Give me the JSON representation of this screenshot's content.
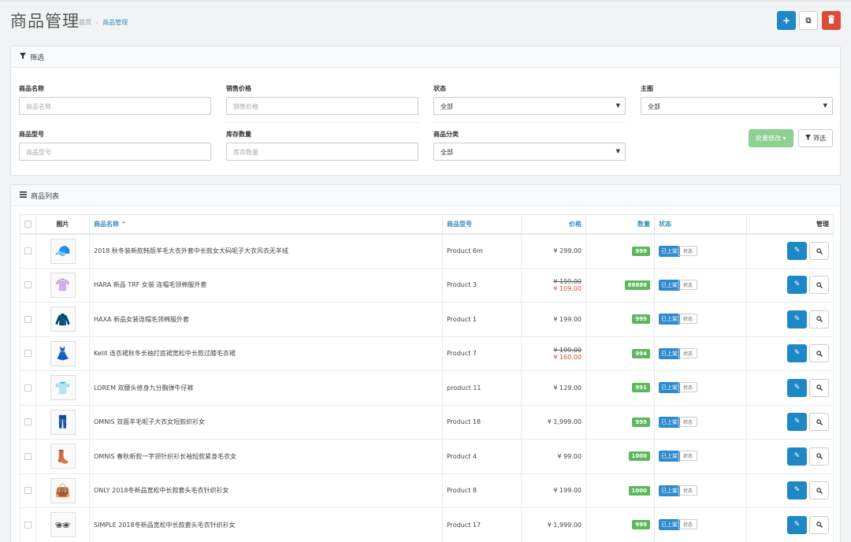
{
  "header": {
    "title": "商品管理",
    "crumb_home": "首页",
    "crumb_sep": "›",
    "crumb_current": "商品管理",
    "add_icon": "+",
    "copy_icon": "⧉",
    "delete_icon": "🗑"
  },
  "filter": {
    "title": "筛选",
    "name_label": "商品名称",
    "name_placeholder": "商品名称",
    "price_label": "销售价格",
    "price_placeholder": "销售价格",
    "status_label": "状态",
    "status_value": "全部",
    "main_label": "主图",
    "main_value": "全部",
    "model_label": "商品型号",
    "model_placeholder": "商品型号",
    "stock_label": "库存数量",
    "stock_placeholder": "库存数量",
    "category_label": "商品分类",
    "category_value": "全部",
    "batch_label": "批量修改",
    "filter_button_label": "筛选"
  },
  "list": {
    "title": "商品列表",
    "columns": {
      "image": "图片",
      "name": "商品名称 ^",
      "model": "商品型号",
      "price": "价格",
      "qty": "数量",
      "status": "状态",
      "manage": "管理"
    },
    "status_on": "已上架",
    "status_off": "状态",
    "rows": [
      {
        "name": "2018 秋冬装新款韩版羊毛大衣外套中长款女大码呢子大衣风衣无羊绒",
        "model": "Product 6m",
        "price": "¥ 299.00",
        "old_price": "",
        "qty": "999",
        "icon": "hat-icon",
        "glyph": "🧢"
      },
      {
        "name": "HARA 新品 TRF 女装 连帽毛领棉服外套",
        "model": "Product 3",
        "price": "¥ 109.00",
        "old_price": "¥ 199.00",
        "qty": "88888",
        "icon": "sweater-icon",
        "glyph": "👚"
      },
      {
        "name": "HAXA 新品女装连帽毛领棉服外套",
        "model": "Product 1",
        "price": "¥ 199.00",
        "old_price": "",
        "qty": "999",
        "icon": "jacket-icon",
        "glyph": "🧥"
      },
      {
        "name": "Kelit 连衣裙秋冬长袖打底裙宽松中长款过膝毛衣裙",
        "model": "Product 7",
        "price": "¥ 160.00",
        "old_price": "¥ 199.00",
        "qty": "994",
        "icon": "dress-icon",
        "glyph": "👗"
      },
      {
        "name": "LOREM 双腰头修身九分胸弹牛仔裤",
        "model": "product 11",
        "price": "¥ 129.00",
        "old_price": "",
        "qty": "991",
        "icon": "shirt-icon",
        "glyph": "👕"
      },
      {
        "name": "OMNIS 双面羊毛呢子大衣女短款织衫女",
        "model": "Product 18",
        "price": "¥ 1,999.00",
        "old_price": "",
        "qty": "999",
        "icon": "pants-icon",
        "glyph": "👖"
      },
      {
        "name": "OMNIS 春秋新款一字领针织衫长袖短款紧身毛衣女",
        "model": "Product 4",
        "price": "¥ 99.00",
        "old_price": "",
        "qty": "1000",
        "icon": "boots-icon",
        "glyph": "👢"
      },
      {
        "name": "ONLY 2018冬新品宽松中长款套头毛衣针织衫女",
        "model": "Product 8",
        "price": "¥ 199.00",
        "old_price": "",
        "qty": "1000",
        "icon": "handbag-icon",
        "glyph": "👜"
      },
      {
        "name": "SIMPLE 2018冬新品宽松中长款套头毛衣针织衫女",
        "model": "Product 17",
        "price": "¥ 1,999.00",
        "old_price": "",
        "qty": "999",
        "icon": "sunglasses-icon",
        "glyph": "🕶"
      }
    ]
  }
}
